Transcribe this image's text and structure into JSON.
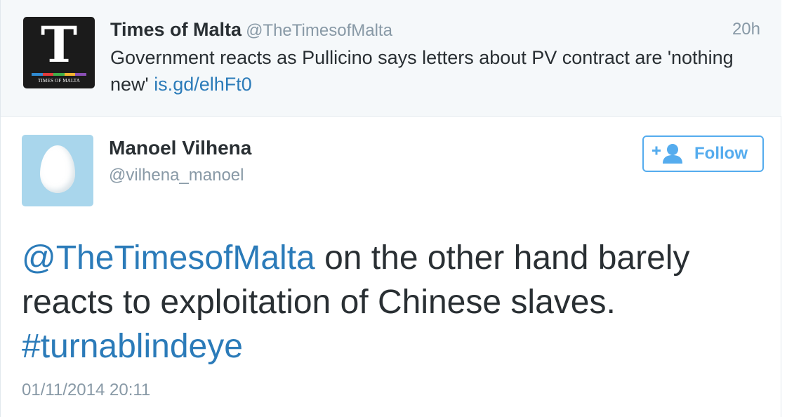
{
  "parent_tweet": {
    "avatar": {
      "letter": "T",
      "caption": "TIMES OF MALTA",
      "stripe_colors": [
        "#2f8ad1",
        "#e23b3b",
        "#3fae49",
        "#f2b230",
        "#8a4fb5"
      ]
    },
    "name": "Times of Malta",
    "handle": "@TheTimesofMalta",
    "time": "20h",
    "text": "Government reacts as Pullicino says letters about PV contract are 'nothing new' ",
    "link": "is.gd/elhFt0"
  },
  "main_tweet": {
    "avatar_icon": "egg-icon",
    "name": "Manoel Vilhena",
    "handle": "@vilhena_manoel",
    "follow_label": "Follow",
    "follow_icon": "add-user-icon",
    "mention": "@TheTimesofMalta",
    "text": " on the other hand barely reacts to exploitation of Chinese slaves. ",
    "hashtag": "#turnablindeye",
    "date": "01/11/2014 20:11"
  },
  "colors": {
    "link": "#2b7bb9",
    "follow": "#55acee",
    "muted": "#8899a6",
    "text": "#292f33",
    "parent_bg": "#f5f8fa",
    "egg_bg": "#a9d6ec"
  }
}
